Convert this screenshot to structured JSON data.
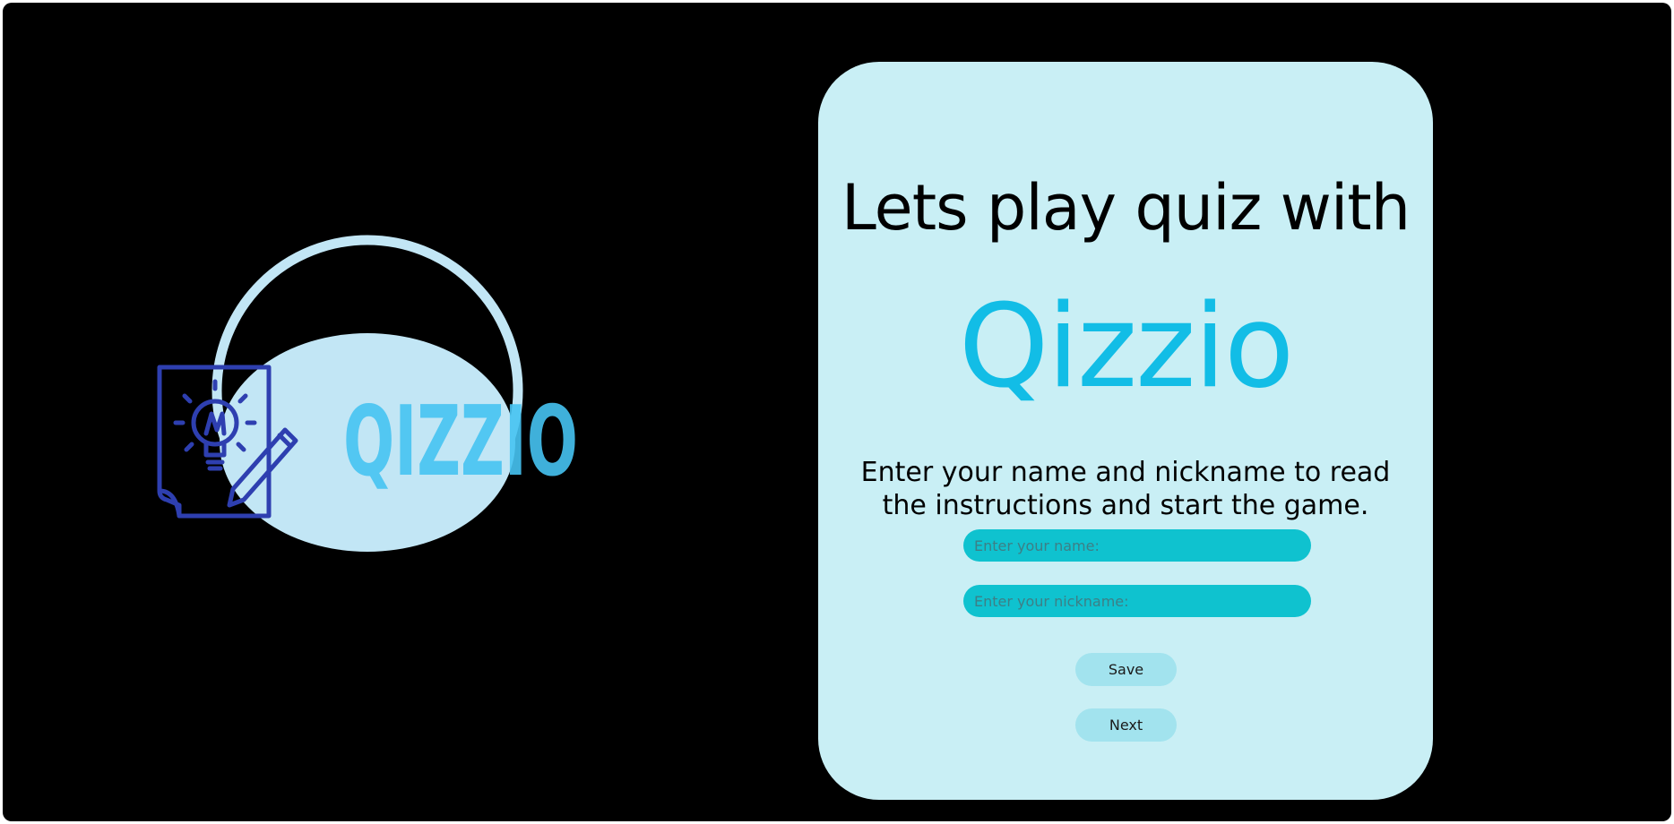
{
  "logo": {
    "wordmark": "QIZZIO",
    "icon": "note-lightbulb-pencil-icon"
  },
  "card": {
    "heading": "Lets play quiz with",
    "brand": "Qizzio",
    "instructions": "Enter your name and nickname to read the instructions and start the game.",
    "name_placeholder": "Enter your name:",
    "nickname_placeholder": "Enter your nickname:",
    "save_label": "Save",
    "next_label": "Next"
  },
  "colors": {
    "background": "#000000",
    "card": "#c9eff5",
    "brand": "#12bde6",
    "input": "#0fc2cf",
    "button": "#a2e3ee",
    "logo_circle": "#c2e6f5",
    "logo_icon": "#2e3fb0",
    "logo_text": "#46c3f2"
  }
}
